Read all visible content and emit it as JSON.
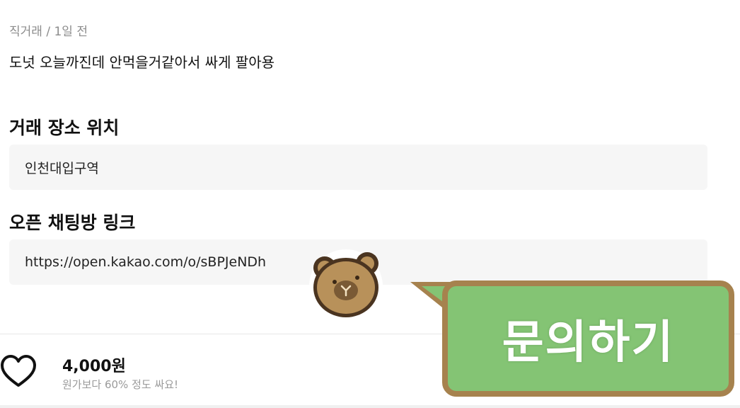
{
  "post": {
    "meta": "직거래 / 1일 전",
    "description": "도넛 오늘까진데 안먹을거같아서 싸게 팔아용"
  },
  "location": {
    "title": "거래 장소 위치",
    "value": "인천대입구역"
  },
  "chat_link": {
    "title": "오픈 채팅방 링크",
    "value": "https://open.kakao.com/o/sBPJeNDh"
  },
  "bottom_bar": {
    "price": "4,000원",
    "price_note": "원가보다 60% 정도 싸요!",
    "ask_button_label": "문의하기"
  },
  "colors": {
    "ask_button_bg": "#84c474",
    "ask_button_border": "#a6824e",
    "field_bg": "#f6f6f6"
  },
  "icons": {
    "favorite": "heart-outline-icon",
    "mascot": "bear-face-icon"
  }
}
